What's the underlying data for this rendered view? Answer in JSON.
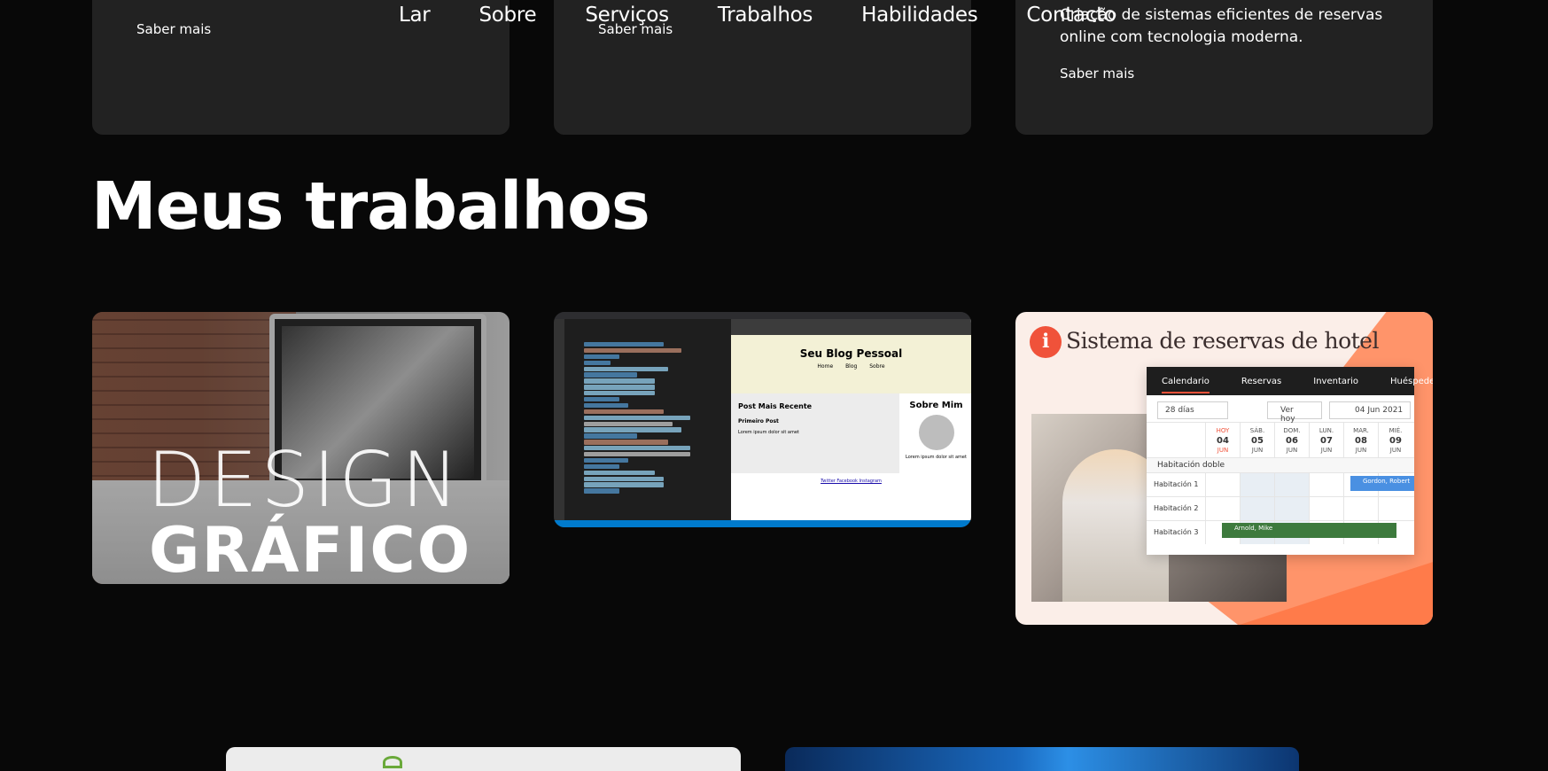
{
  "nav": {
    "items": [
      "Lar",
      "Sobre",
      "Serviços",
      "Trabalhos",
      "Habilidades",
      "Contacto"
    ]
  },
  "services": {
    "cards": [
      {
        "link": "Saber mais"
      },
      {
        "link": "Saber mais"
      },
      {
        "desc": "Criação de sistemas eficientes de reservas online com tecnologia moderna.",
        "link": "Saber mais"
      }
    ]
  },
  "works": {
    "title": "Meus trabalhos",
    "design": {
      "line1": "DESIGN",
      "line2": "GRÁFICO"
    },
    "blog": {
      "title": "Seu Blog Pessoal",
      "nav": [
        "Home",
        "Blog",
        "Sobre"
      ],
      "post_heading": "Post Mais Recente",
      "post_title": "Primeiro Post",
      "post_text": "Lorem ipsum dolor sit amet",
      "about_heading": "Sobre Mim",
      "about_text": "Lorem ipsum dolor sit amet",
      "footer": "Twitter Facebook Instagram"
    },
    "hotel": {
      "title": "Sistema de reservas de hotel",
      "tabs": [
        "Calendario",
        "Reservas",
        "Inventario",
        "Huéspedes"
      ],
      "range": "28 días",
      "today_btn": "Ver hoy",
      "date": "04 Jun 2021",
      "days": [
        {
          "dow": "HOY",
          "num": "04",
          "mon": "JUN"
        },
        {
          "dow": "SÁB.",
          "num": "05",
          "mon": "JUN"
        },
        {
          "dow": "DOM.",
          "num": "06",
          "mon": "JUN"
        },
        {
          "dow": "LUN.",
          "num": "07",
          "mon": "JUN"
        },
        {
          "dow": "MAR.",
          "num": "08",
          "mon": "JUN"
        },
        {
          "dow": "MIÉ.",
          "num": "09",
          "mon": "JUN"
        }
      ],
      "group": "Habitación doble",
      "rooms": [
        "Habitación 1",
        "Habitación 2",
        "Habitación 3"
      ],
      "bookings": [
        "Gordon, Robert",
        "Arnold, Mike"
      ]
    }
  }
}
